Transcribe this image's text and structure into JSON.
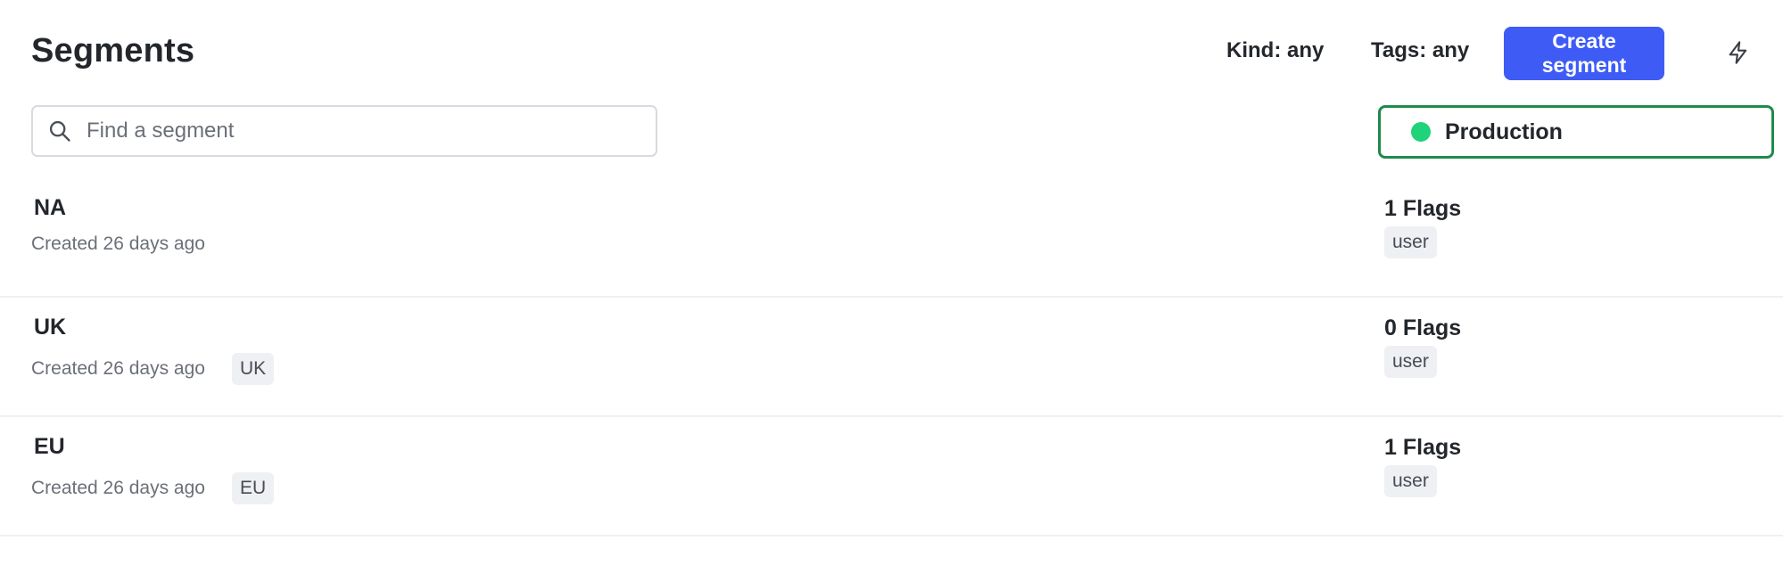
{
  "header": {
    "title": "Segments",
    "kind_filter": "Kind: any",
    "tags_filter": "Tags: any",
    "create_button": "Create segment",
    "icon": "bolt-icon"
  },
  "search": {
    "placeholder": "Find a segment",
    "value": ""
  },
  "environment": {
    "label": "Production",
    "status_color": "#1ed37a",
    "border_color": "#1f8a4c"
  },
  "colors": {
    "accent": "#3e5cf5"
  },
  "segments": [
    {
      "name": "NA",
      "created": "Created 26 days ago",
      "tag": "",
      "flags": "1 Flags",
      "kind": "user"
    },
    {
      "name": "UK",
      "created": "Created 26 days ago",
      "tag": "UK",
      "flags": "0 Flags",
      "kind": "user"
    },
    {
      "name": "EU",
      "created": "Created 26 days ago",
      "tag": "EU",
      "flags": "1 Flags",
      "kind": "user"
    }
  ]
}
